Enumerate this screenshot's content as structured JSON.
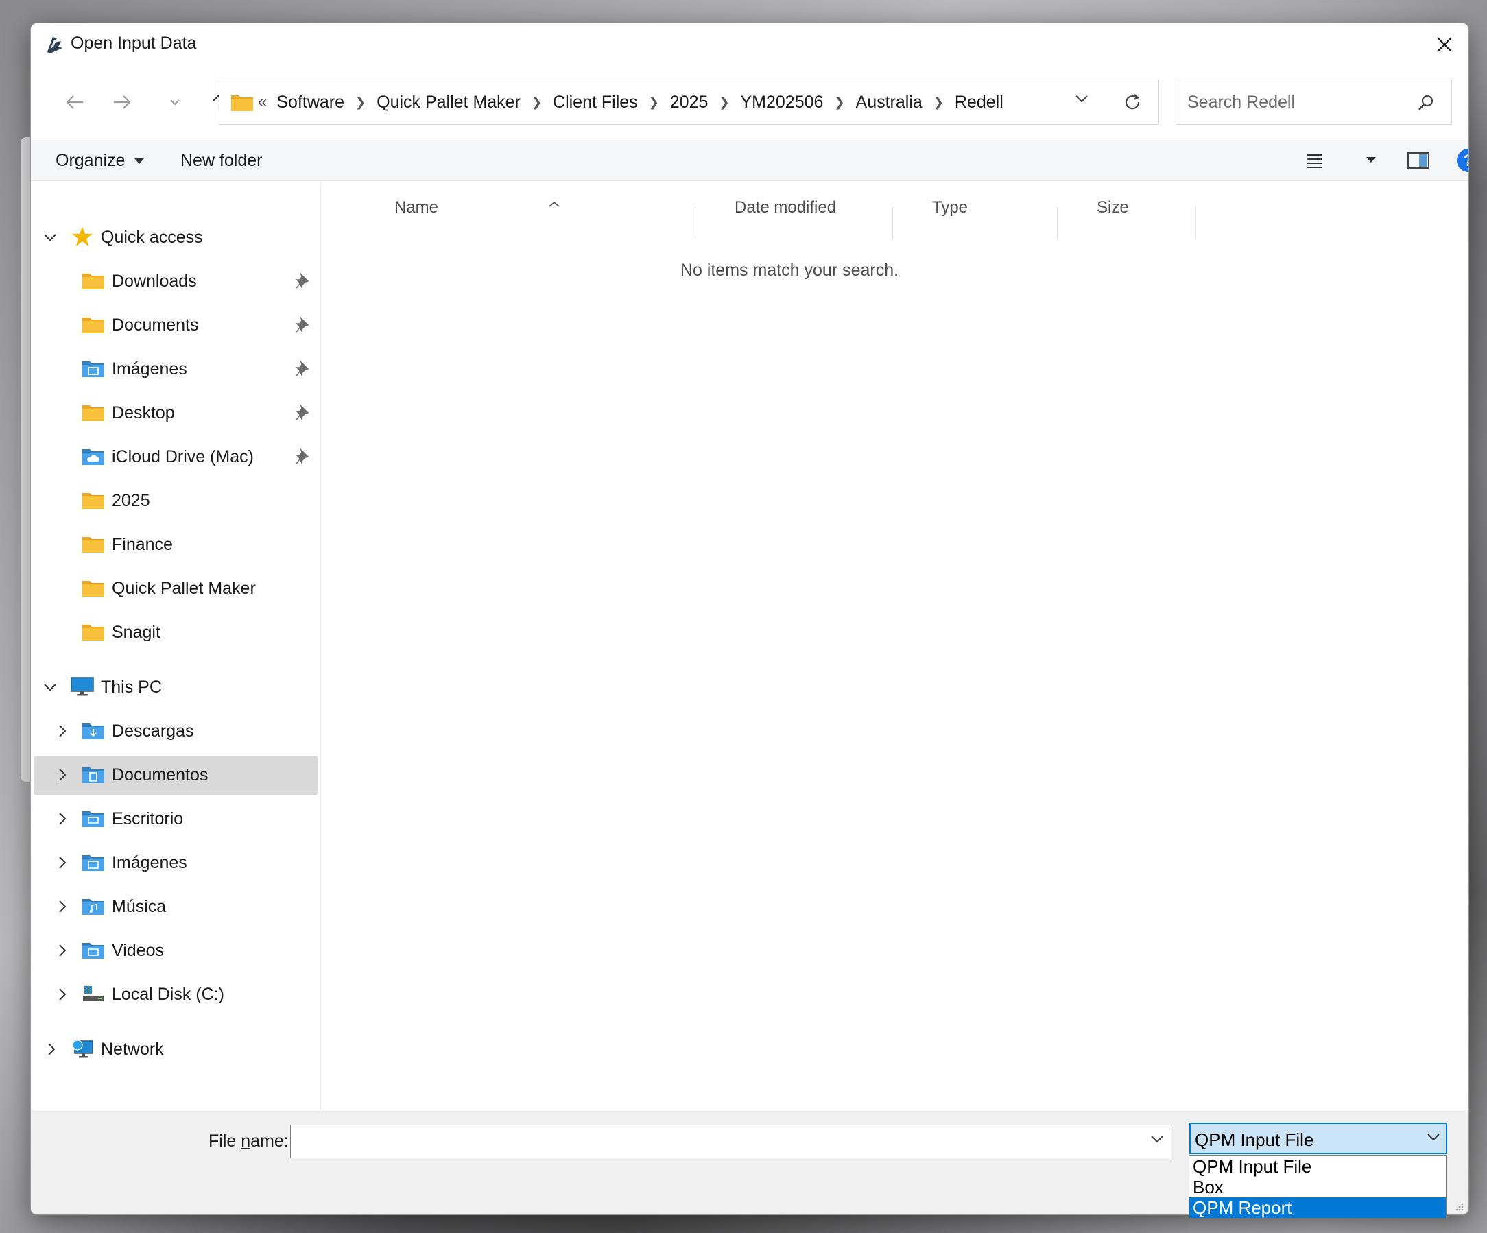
{
  "window": {
    "title": "Open Input Data"
  },
  "address_bar": {
    "overflow_glyph": "«",
    "breadcrumbs": [
      "Software",
      "Quick Pallet Maker",
      "Client Files",
      "2025",
      "YM202506",
      "Australia",
      "Redell"
    ]
  },
  "search": {
    "placeholder": "Search Redell"
  },
  "toolbar": {
    "organize_label": "Organize",
    "new_folder_label": "New folder"
  },
  "sidebar": {
    "quick_access": {
      "label": "Quick access",
      "items": [
        {
          "label": "Downloads",
          "icon": "folder-icon",
          "pinned": true
        },
        {
          "label": "Documents",
          "icon": "folder-icon",
          "pinned": true
        },
        {
          "label": "Imágenes",
          "icon": "pictures-folder-icon",
          "pinned": true
        },
        {
          "label": "Desktop",
          "icon": "folder-icon",
          "pinned": true
        },
        {
          "label": "iCloud Drive (Mac)",
          "icon": "icloud-folder-icon",
          "pinned": true
        },
        {
          "label": "2025",
          "icon": "folder-icon",
          "pinned": false
        },
        {
          "label": "Finance",
          "icon": "folder-icon",
          "pinned": false
        },
        {
          "label": "Quick Pallet Maker",
          "icon": "folder-icon",
          "pinned": false
        },
        {
          "label": "Snagit",
          "icon": "folder-icon",
          "pinned": false
        }
      ]
    },
    "this_pc": {
      "label": "This PC",
      "items": [
        {
          "label": "Descargas",
          "icon": "downloads-folder-icon"
        },
        {
          "label": "Documentos",
          "icon": "documents-folder-icon",
          "selected": true
        },
        {
          "label": "Escritorio",
          "icon": "desktop-folder-icon"
        },
        {
          "label": "Imágenes",
          "icon": "pictures-folder-icon"
        },
        {
          "label": "Música",
          "icon": "music-folder-icon"
        },
        {
          "label": "Videos",
          "icon": "videos-folder-icon"
        },
        {
          "label": "Local Disk (C:)",
          "icon": "disk-icon"
        }
      ]
    },
    "network": {
      "label": "Network"
    }
  },
  "file_list": {
    "columns": [
      "Name",
      "Date modified",
      "Type",
      "Size"
    ],
    "sorted_column": "Name",
    "empty_message": "No items match your search."
  },
  "footer": {
    "file_name_label_prefix": "File ",
    "file_name_label_underlined": "n",
    "file_name_label_suffix": "ame:",
    "file_name_value": "",
    "file_type_selected": "QPM Input File",
    "file_type_options": [
      "QPM Input File",
      "Box",
      "QPM Report"
    ],
    "file_type_highlighted": "QPM Report"
  },
  "colors": {
    "accent": "#0078d4",
    "folder_yellow": "#f8c13c",
    "selection_gray": "#d9d9d9",
    "help_blue": "#1a73e8"
  }
}
